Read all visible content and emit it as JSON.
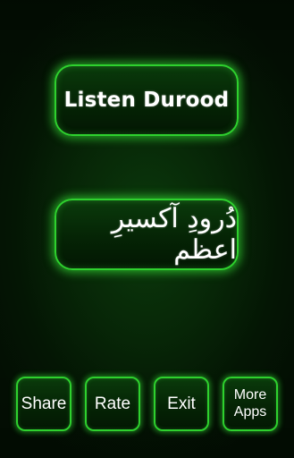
{
  "main": {
    "listen_label": "Listen Durood",
    "durood_label": "دُرودِ آکسیرِ اعظم"
  },
  "footer": {
    "share_label": "Share",
    "rate_label": "Rate",
    "exit_label": "Exit",
    "more_apps_label": "More\nApps"
  },
  "colors": {
    "accent_glow": "#2ed12e",
    "background": "#072607",
    "text": "#ffffff"
  }
}
